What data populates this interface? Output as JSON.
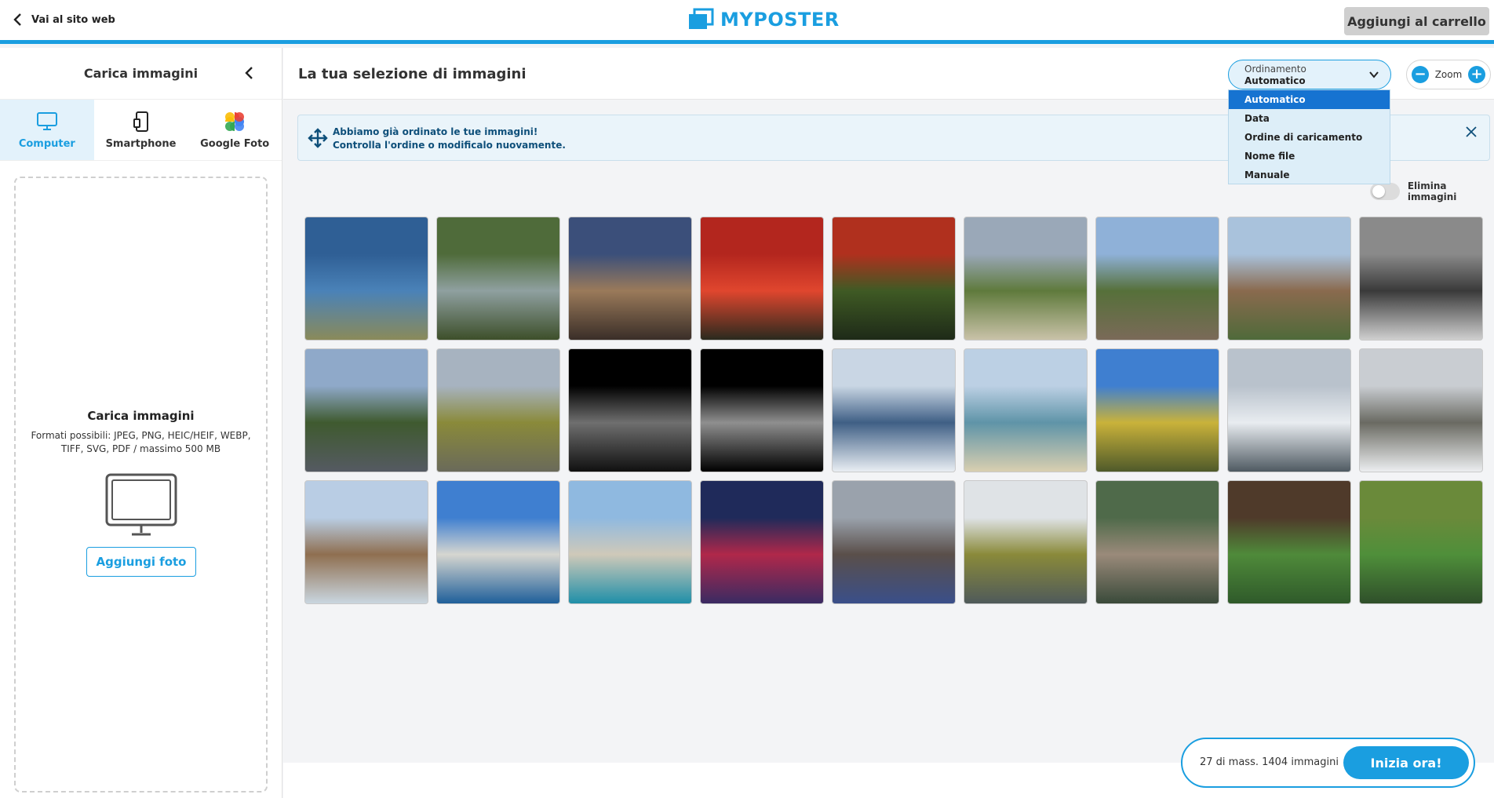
{
  "topbar": {
    "back_label": "Vai al sito web",
    "logo_text": "MYPOSTER",
    "cart_label": "Aggiungi al carrello"
  },
  "sidebar": {
    "title": "Carica immagini",
    "sources": [
      {
        "label": "Computer",
        "icon": "monitor-icon",
        "active": true
      },
      {
        "label": "Smartphone",
        "icon": "smartphone-icon",
        "active": false
      },
      {
        "label": "Google Foto",
        "icon": "google-photos-icon",
        "active": false
      }
    ],
    "dropzone": {
      "title": "Carica immagini",
      "formats": "Formati possibili: JPEG, PNG, HEIC/HEIF, WEBP, TIFF, SVG, PDF / massimo 500 MB",
      "add_label": "Aggiungi foto"
    }
  },
  "main": {
    "title": "La tua selezione di immagini",
    "sort": {
      "label": "Ordinamento",
      "value": "Automatico",
      "options": [
        "Automatico",
        "Data",
        "Ordine di caricamento",
        "Nome file",
        "Manuale"
      ]
    },
    "zoom": {
      "label": "Zoom",
      "minus": "−",
      "plus": "+"
    },
    "banner": {
      "line1": "Abbiamo già ordinato le tue immagini!",
      "line2": "Controlla l'ordine o modificalo nuovamente."
    },
    "delete_toggle_label": "Elimina immagini"
  },
  "photos": [
    {
      "subject": "sea-rocks",
      "colors": [
        "#2f5f95",
        "#4a82b8",
        "#8a8a5a"
      ]
    },
    {
      "subject": "mountain-stream",
      "colors": [
        "#4f6b3a",
        "#8fa0a0",
        "#3d4f2a"
      ]
    },
    {
      "subject": "notre-dame",
      "colors": [
        "#3b4f7a",
        "#9a7a5a",
        "#3a2e28"
      ]
    },
    {
      "subject": "red-tree",
      "colors": [
        "#b3261e",
        "#e0462e",
        "#2a2a1e"
      ]
    },
    {
      "subject": "red-tree-pond",
      "colors": [
        "#b0301e",
        "#3f5a24",
        "#1e2a18"
      ]
    },
    {
      "subject": "vineyard",
      "colors": [
        "#9aa8b8",
        "#5f7a3c",
        "#c9c2a8"
      ]
    },
    {
      "subject": "hills-town",
      "colors": [
        "#8fb1d8",
        "#56703a",
        "#7a6a58"
      ]
    },
    {
      "subject": "old-town",
      "colors": [
        "#a9c2dc",
        "#8a6a4e",
        "#4f6a3a"
      ]
    },
    {
      "subject": "bw-town",
      "colors": [
        "#8a8a8a",
        "#3a3a3a",
        "#cfcfcf"
      ]
    },
    {
      "subject": "palm-avenue",
      "colors": [
        "#8fa9c9",
        "#3f5a2f",
        "#555a62"
      ]
    },
    {
      "subject": "autumn-lake",
      "colors": [
        "#a7b3c0",
        "#8a8a3a",
        "#6a6a5a"
      ]
    },
    {
      "subject": "moon-crescent",
      "colors": [
        "#000000",
        "#6f6f6f",
        "#101010"
      ]
    },
    {
      "subject": "full-moon",
      "colors": [
        "#000000",
        "#8f8f8f",
        "#000000"
      ]
    },
    {
      "subject": "snow-river",
      "colors": [
        "#c9d6e4",
        "#3f5f85",
        "#e9eef3"
      ]
    },
    {
      "subject": "beach-coast",
      "colors": [
        "#bcd0e4",
        "#5f94a8",
        "#d9cfb0"
      ]
    },
    {
      "subject": "yellow-trees",
      "colors": [
        "#3f7fd0",
        "#c9b23a",
        "#4f5a2a"
      ]
    },
    {
      "subject": "snow-park",
      "colors": [
        "#b9c2cc",
        "#e8ecf0",
        "#4f5a62"
      ]
    },
    {
      "subject": "snow-trees",
      "colors": [
        "#c9cdd2",
        "#6a6a62",
        "#eceef0"
      ]
    },
    {
      "subject": "swans-lake",
      "colors": [
        "#b9cde4",
        "#8f6f50",
        "#c9d6e0"
      ]
    },
    {
      "subject": "white-cliffs",
      "colors": [
        "#3f7fd0",
        "#d6d6d0",
        "#1f5f9a"
      ]
    },
    {
      "subject": "turquoise-bay",
      "colors": [
        "#8fb9e0",
        "#cfc9b9",
        "#1f8fa8"
      ]
    },
    {
      "subject": "neon-building",
      "colors": [
        "#1f2a5a",
        "#b0284a",
        "#3a2a62"
      ]
    },
    {
      "subject": "fairground",
      "colors": [
        "#9aa2ac",
        "#5a4f4a",
        "#3a4f8a"
      ]
    },
    {
      "subject": "lake-reflection",
      "colors": [
        "#dfe3e6",
        "#8a8a3a",
        "#4f5a5a"
      ]
    },
    {
      "subject": "manul-cat",
      "colors": [
        "#4f6a4a",
        "#9a8a7a",
        "#3a4a3a"
      ]
    },
    {
      "subject": "lotus-pavilion",
      "colors": [
        "#4f3a2a",
        "#4f8a3a",
        "#2f5a2a"
      ]
    },
    {
      "subject": "lotus-leaves",
      "colors": [
        "#6a8a3a",
        "#4f8f3a",
        "#2f4f2a"
      ]
    }
  ],
  "footer": {
    "count_text": "27 di mass. 1404 immagini",
    "start_label": "Inizia ora!"
  },
  "colors": {
    "accent": "#1a9ee0",
    "selected_option": "#1673d1"
  }
}
